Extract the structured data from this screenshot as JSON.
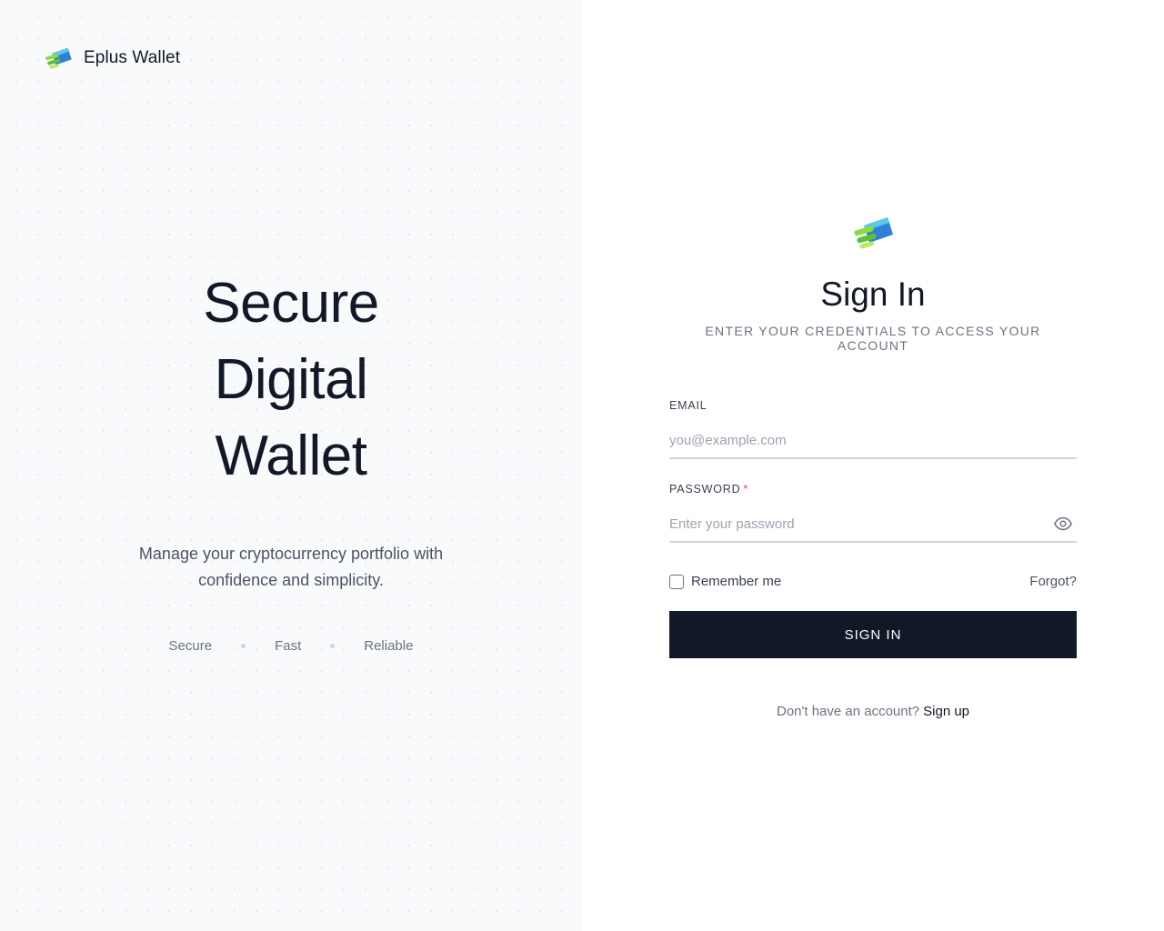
{
  "brand": {
    "name": "Eplus Wallet",
    "logo_icon": "wallet-logo-icon",
    "colors": {
      "green": "#8bdc3a",
      "blue": "#2f7fd8",
      "cyan": "#58c9e8"
    }
  },
  "hero": {
    "title_lines": [
      "Secure",
      "Digital",
      "Wallet"
    ],
    "subtitle": "Manage your cryptocurrency portfolio with confidence and simplicity.",
    "features": [
      "Secure",
      "Fast",
      "Reliable"
    ]
  },
  "form": {
    "title": "Sign In",
    "subtitle": "ENTER YOUR CREDENTIALS TO ACCESS YOUR ACCOUNT",
    "email": {
      "label": "EMAIL",
      "placeholder": "you@example.com",
      "value": ""
    },
    "password": {
      "label": "PASSWORD",
      "required_mark": "*",
      "placeholder": "Enter your password",
      "value": "",
      "toggle_icon": "eye-icon"
    },
    "remember_label": "Remember me",
    "remember_checked": false,
    "forgot_label": "Forgot?",
    "submit_label": "SIGN IN",
    "signup_prompt": "Don't have an account?",
    "signup_label": "Sign up"
  },
  "colors": {
    "primary": "#111827",
    "muted": "#6b7280",
    "required": "#ef4444",
    "left_panel_bg": "#f8fafc"
  }
}
